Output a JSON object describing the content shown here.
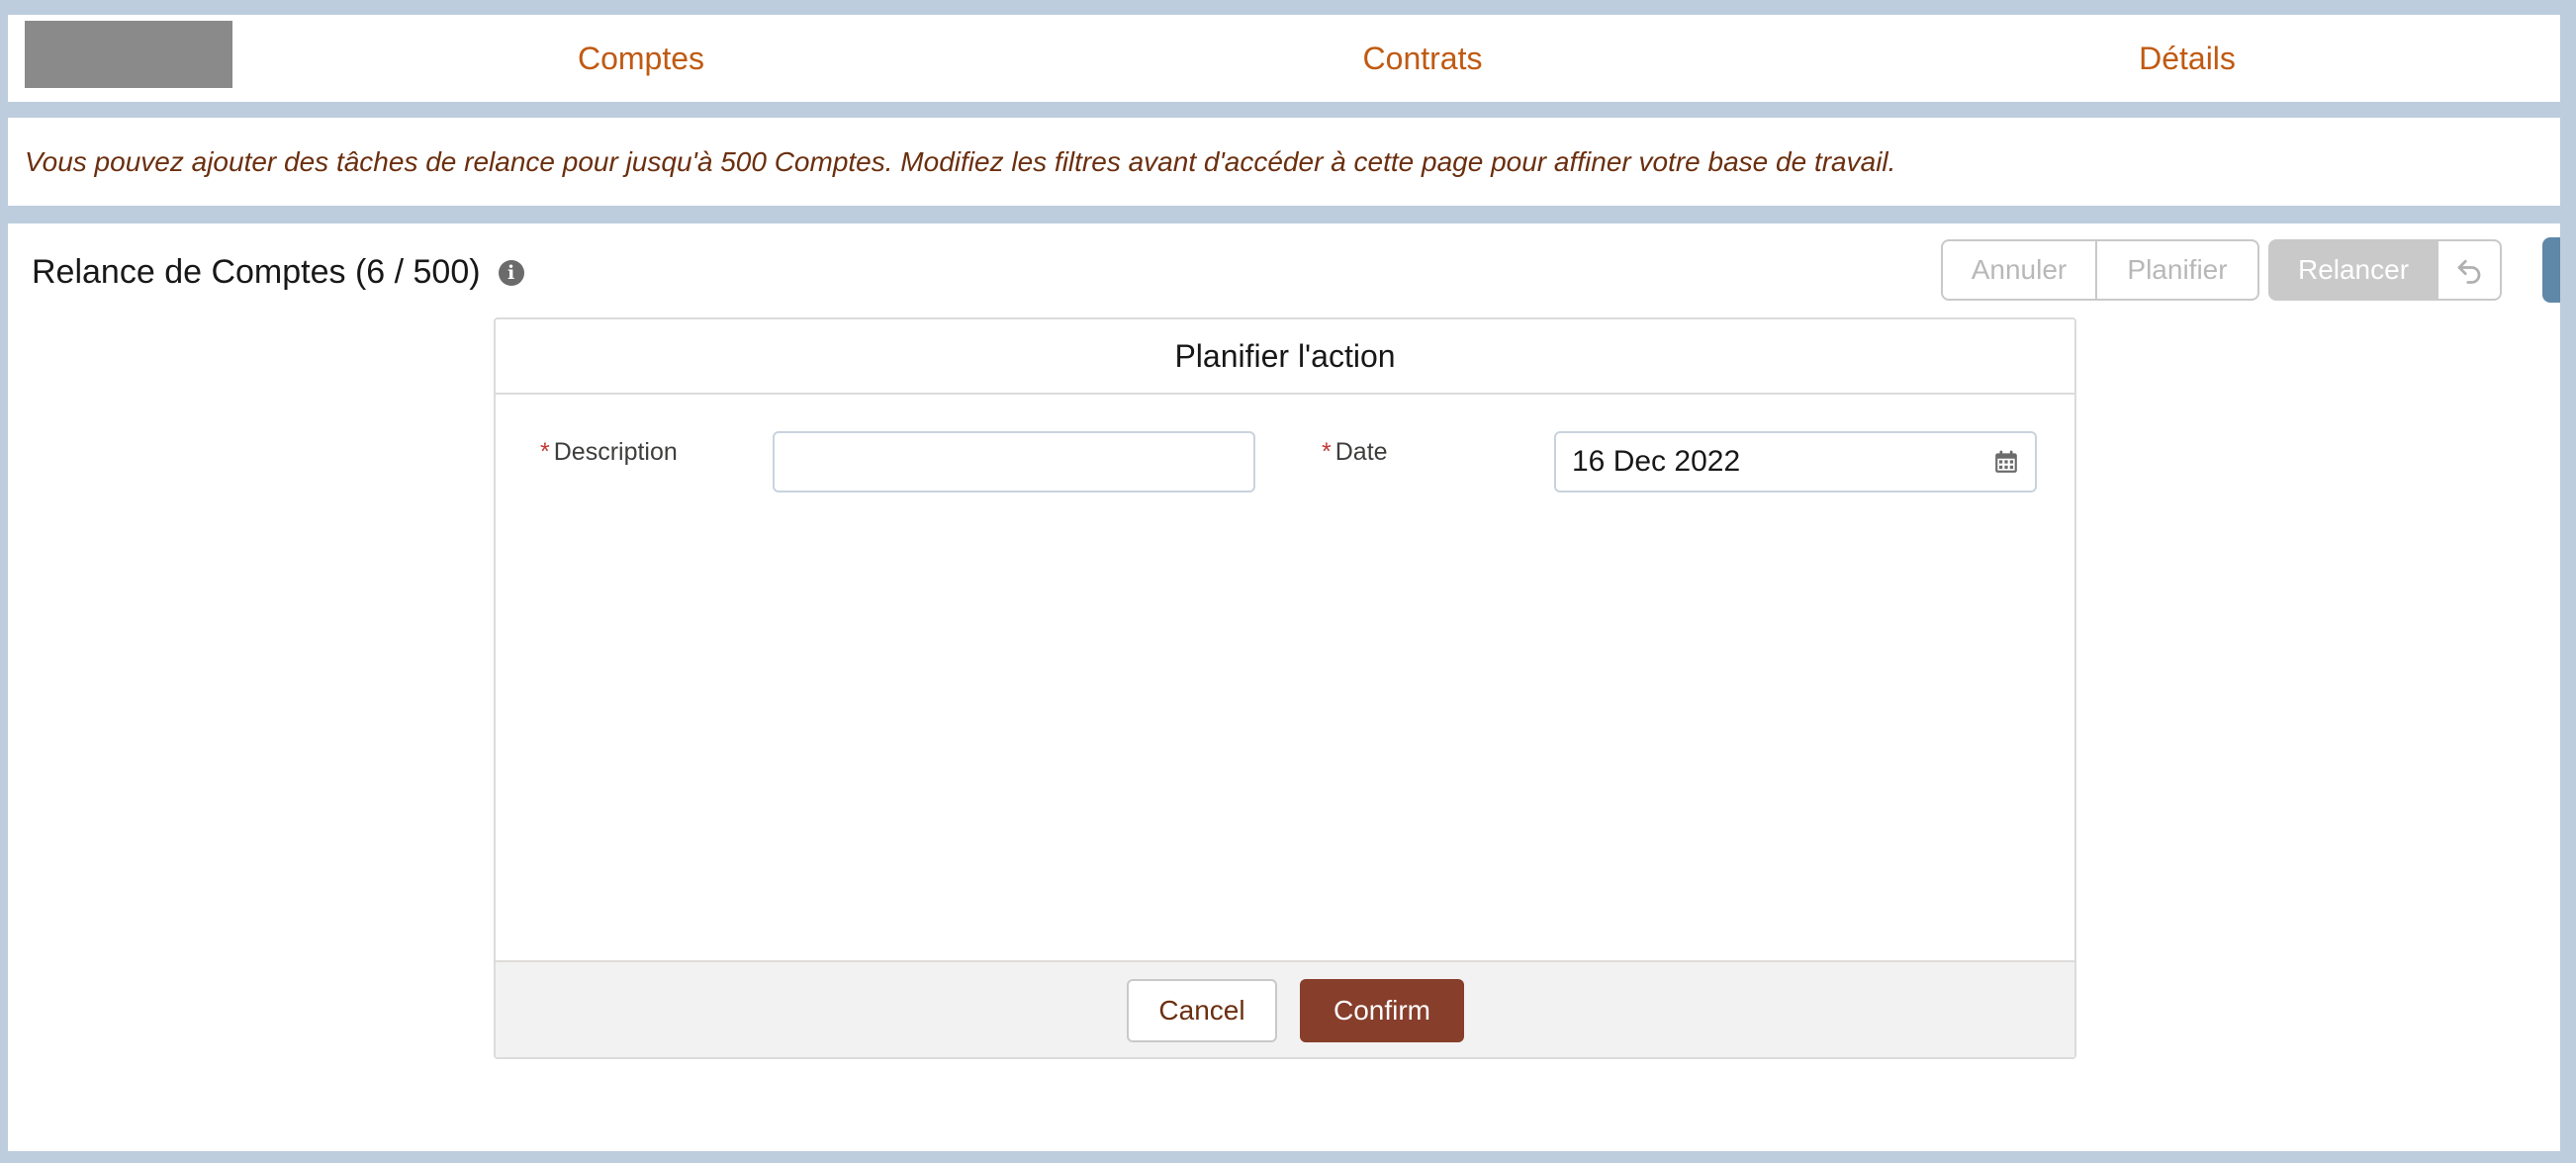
{
  "nav": {
    "logo": "",
    "tabs": [
      {
        "label": "Comptes"
      },
      {
        "label": "Contrats"
      },
      {
        "label": "Détails"
      }
    ]
  },
  "banner": {
    "text": "Vous pouvez ajouter des tâches de relance pour jusqu'à 500 Comptes. Modifiez les filtres avant d'accéder à cette page pour affiner votre base de travail."
  },
  "main": {
    "title": "Relance de Comptes (6 / 500)",
    "info_icon": "info-icon",
    "actions": {
      "annuler": "Annuler",
      "planifier": "Planifier",
      "relancer": "Relancer",
      "undo_icon": "undo-icon"
    }
  },
  "modal": {
    "title": "Planifier l'action",
    "description_label": "Description",
    "description_value": "",
    "date_label": "Date",
    "date_value": "16 Dec 2022",
    "required_marker": "*",
    "cancel_label": "Cancel",
    "confirm_label": "Confirm"
  },
  "colors": {
    "accent": "#c05a12",
    "banner_text": "#6b2f0f",
    "confirm_bg": "#873e2b",
    "page_bg": "#bdcddd"
  }
}
